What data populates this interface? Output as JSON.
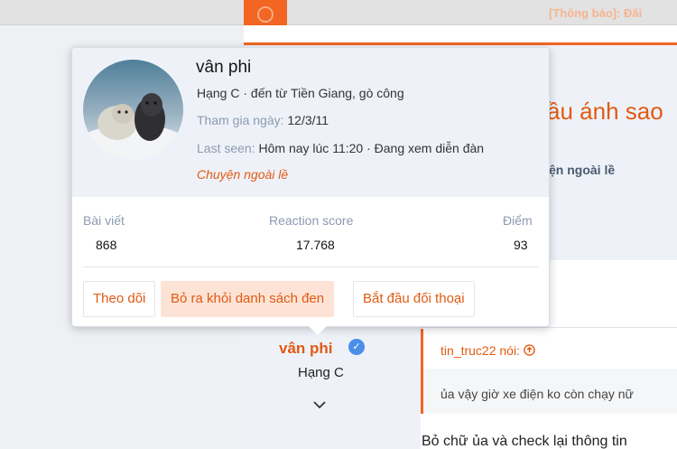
{
  "topbar": {
    "notice": "[Thông báo]: Đăi"
  },
  "thread": {
    "title_fragment": "ầu ánh sao",
    "forum_fragment": "ện ngoài lề"
  },
  "post": {
    "username": "vân phi",
    "rank": "Hạng C",
    "quote_author": "tin_truc22 nói:",
    "quote_text": "ủa vậy giờ xe điện ko còn chạy nữ",
    "body_text": "Bỏ chữ ủa và check lại thông tin"
  },
  "card": {
    "name": "vân phi",
    "rank_location": "Hạng C · đến từ Tiền Giang, gò công",
    "joined_label": "Tham gia ngày:",
    "joined_value": "12/3/11",
    "last_seen_label": "Last seen:",
    "last_seen_value": "Hôm nay lúc 11:20 · Đang xem diễn đàn",
    "location_link": "Chuyện ngoài lề",
    "stats": {
      "posts_label": "Bài viết",
      "posts_value": "868",
      "reaction_label": "Reaction score",
      "reaction_value": "17.768",
      "points_label": "Điểm",
      "points_value": "93"
    },
    "buttons": {
      "follow": "Theo dõi",
      "unblock": "Bỏ ra khỏi danh sách đen",
      "start_conversation": "Bắt đầu đối thoại"
    }
  },
  "colors": {
    "accent": "#f26522",
    "link": "#e25a12",
    "muted": "#8c9ab0",
    "verified": "#4a8ee8"
  },
  "icons": {
    "verified": "verified-check-icon",
    "quote_jump": "arrow-up-circle-icon",
    "expand": "chevron-down-icon"
  }
}
